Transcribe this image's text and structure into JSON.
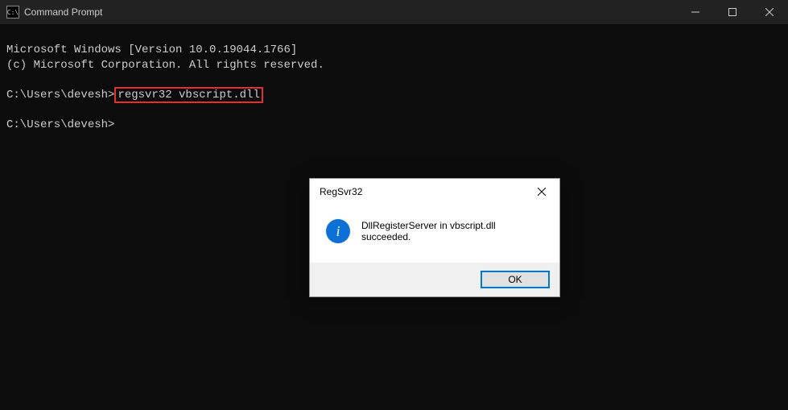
{
  "titlebar": {
    "icon_text": "C:\\",
    "title": "Command Prompt"
  },
  "terminal": {
    "line1": "Microsoft Windows [Version 10.0.19044.1766]",
    "line2": "(c) Microsoft Corporation. All rights reserved.",
    "prompt1_prefix": "C:\\Users\\devesh>",
    "prompt1_cmd": "regsvr32 vbscript.dll",
    "prompt2": "C:\\Users\\devesh>"
  },
  "dialog": {
    "title": "RegSvr32",
    "message": "DllRegisterServer in vbscript.dll succeeded.",
    "ok_label": "OK",
    "info_glyph": "i"
  }
}
